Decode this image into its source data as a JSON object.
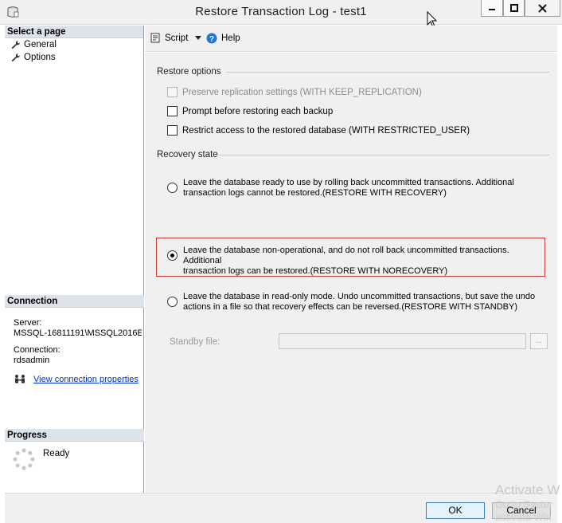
{
  "window": {
    "title": "Restore Transaction Log  -  test1",
    "minimize_glyph": "─",
    "maximize_glyph": "□",
    "close_glyph": "✕"
  },
  "left_pane": {
    "select_page_header": "Select a page",
    "pages": [
      {
        "label": "General",
        "icon": "wrench-icon"
      },
      {
        "label": "Options",
        "icon": "wrench-icon"
      }
    ],
    "connection": {
      "header": "Connection",
      "server_label": "Server:",
      "server_value": "MSSQL-16811191\\MSSQL2016E",
      "connection_label": "Connection:",
      "connection_value": "rdsadmin",
      "view_properties_link": "View connection properties"
    },
    "progress": {
      "header": "Progress",
      "status": "Ready"
    }
  },
  "toolbar": {
    "script_label": "Script",
    "help_label": "Help"
  },
  "restore_options": {
    "title": "Restore options",
    "checkboxes": [
      {
        "label": "Preserve replication settings (WITH KEEP_REPLICATION)",
        "checked": false,
        "enabled": false
      },
      {
        "label": "Prompt before restoring each backup",
        "checked": false,
        "enabled": true
      },
      {
        "label": "Restrict access to the restored database (WITH RESTRICTED_USER)",
        "checked": false,
        "enabled": true
      }
    ]
  },
  "recovery_state": {
    "title": "Recovery state",
    "options": [
      {
        "line1": "Leave the database ready to use by rolling back uncommitted transactions. Additional",
        "line2": "transaction logs cannot be restored.(RESTORE WITH RECOVERY)",
        "selected": false
      },
      {
        "line1": "Leave the database non-operational, and do not roll back uncommitted transactions. Additional",
        "line2": "transaction logs can be restored.(RESTORE WITH NORECOVERY)",
        "selected": true
      },
      {
        "line1": "Leave the database in read-only mode. Undo uncommitted transactions, but save the undo",
        "line2": "actions in a file so that recovery effects can be reversed.(RESTORE WITH STANDBY)",
        "selected": false
      }
    ],
    "standby_label": "Standby file:",
    "standby_value": "",
    "browse_label": "..."
  },
  "buttons": {
    "ok": "OK",
    "cancel": "Cancel"
  },
  "watermark": {
    "line1": "Activate W",
    "line2": "Go to Syster",
    "line3": "activate Win"
  },
  "colors": {
    "highlight_border": "#d23a3a",
    "link": "#0033cc",
    "help_icon": "#1e78d6",
    "header_bg": "#dde3ea"
  }
}
